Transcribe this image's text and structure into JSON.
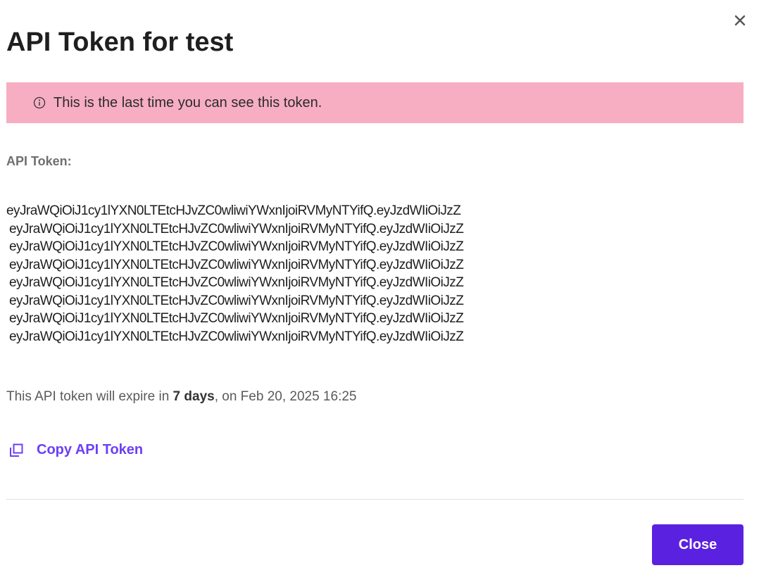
{
  "dialog": {
    "title": "API Token for test",
    "close_icon": "close-icon",
    "warning": {
      "icon": "info-icon",
      "text": "This is the last time you can see this token."
    },
    "token_label": "API Token:",
    "token_lines": [
      "eyJraWQiOiJ1cy1lYXN0LTEtcHJvZC0wliwiYWxnIjoiRVMyNTYifQ.eyJzdWIiOiJzZ",
      "eyJraWQiOiJ1cy1lYXN0LTEtcHJvZC0wliwiYWxnIjoiRVMyNTYifQ.eyJzdWIiOiJzZ",
      "eyJraWQiOiJ1cy1lYXN0LTEtcHJvZC0wliwiYWxnIjoiRVMyNTYifQ.eyJzdWIiOiJzZ",
      "eyJraWQiOiJ1cy1lYXN0LTEtcHJvZC0wliwiYWxnIjoiRVMyNTYifQ.eyJzdWIiOiJzZ",
      "eyJraWQiOiJ1cy1lYXN0LTEtcHJvZC0wliwiYWxnIjoiRVMyNTYifQ.eyJzdWIiOiJzZ",
      "eyJraWQiOiJ1cy1lYXN0LTEtcHJvZC0wliwiYWxnIjoiRVMyNTYifQ.eyJzdWIiOiJzZ",
      "eyJraWQiOiJ1cy1lYXN0LTEtcHJvZC0wliwiYWxnIjoiRVMyNTYifQ.eyJzdWIiOiJzZ",
      "eyJraWQiOiJ1cy1lYXN0LTEtcHJvZC0wliwiYWxnIjoiRVMyNTYifQ.eyJzdWIiOiJzZ"
    ],
    "expiry": {
      "prefix": "This API token will expire in ",
      "duration": "7 days",
      "suffix": ", on Feb 20, 2025 16:25"
    },
    "copy_link": {
      "icon": "copy-icon",
      "label": "Copy API Token"
    },
    "close_button": "Close"
  },
  "colors": {
    "warning_bg": "#f7aec2",
    "accent": "#6c3ff5",
    "button_bg": "#5b21e0",
    "divider": "#e2e2e2"
  }
}
